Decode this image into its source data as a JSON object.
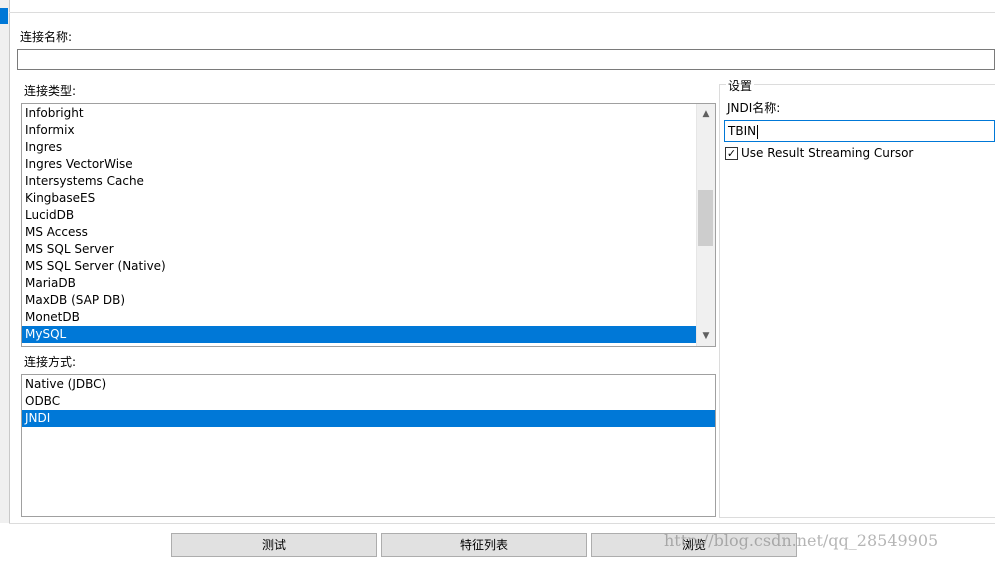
{
  "connection_name": {
    "label": "连接名称:",
    "value": ""
  },
  "connection_type": {
    "label": "连接类型:",
    "items": [
      "Infobright",
      "Informix",
      "Ingres",
      "Ingres VectorWise",
      "Intersystems Cache",
      "KingbaseES",
      "LucidDB",
      "MS Access",
      "MS SQL Server",
      "MS SQL Server (Native)",
      "MariaDB",
      "MaxDB (SAP DB)",
      "MonetDB",
      "MySQL"
    ],
    "selected": "MySQL",
    "scroll_up": "▲",
    "scroll_down": "▼"
  },
  "access_method": {
    "label": "连接方式:",
    "items": [
      "Native (JDBC)",
      "ODBC",
      "JNDI"
    ],
    "selected": "JNDI"
  },
  "settings": {
    "legend": "设置",
    "jndi_label": "JNDI名称:",
    "jndi_value": "TBIN",
    "streaming_cursor_label": "Use Result Streaming Cursor",
    "streaming_cursor_checked": true,
    "check_mark": "✓"
  },
  "buttons": {
    "test": "测试",
    "feature_list": "特征列表",
    "browse": "浏览"
  },
  "watermark": "http://blog.csdn.net/qq_28549905",
  "colors": {
    "selection": "#0078d7",
    "focus_border": "#0078d7"
  }
}
